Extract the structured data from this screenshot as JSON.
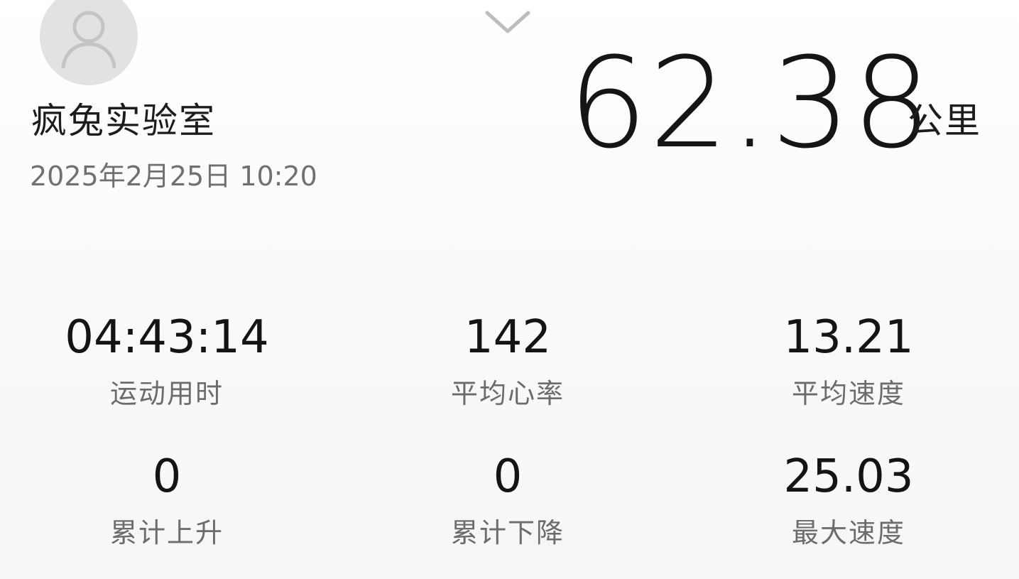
{
  "header": {
    "avatar_icon": "user-avatar-icon",
    "collapse_icon": "chevron-down-icon",
    "username": "疯兔实验室",
    "datetime": "2025年2月25日 10:20"
  },
  "distance": {
    "value": "62.38",
    "unit": "公里"
  },
  "stats": [
    {
      "value": "04:43:14",
      "label": "运动用时"
    },
    {
      "value": "142",
      "label": "平均心率"
    },
    {
      "value": "13.21",
      "label": "平均速度"
    },
    {
      "value": "0",
      "label": "累计上升"
    },
    {
      "value": "0",
      "label": "累计下降"
    },
    {
      "value": "25.03",
      "label": "最大速度"
    }
  ],
  "colors": {
    "avatar_bg": "#e2e2e2",
    "primary_text": "#1c1c1c",
    "secondary_text": "#6c6c6c",
    "chevron": "#bdbdbd"
  }
}
